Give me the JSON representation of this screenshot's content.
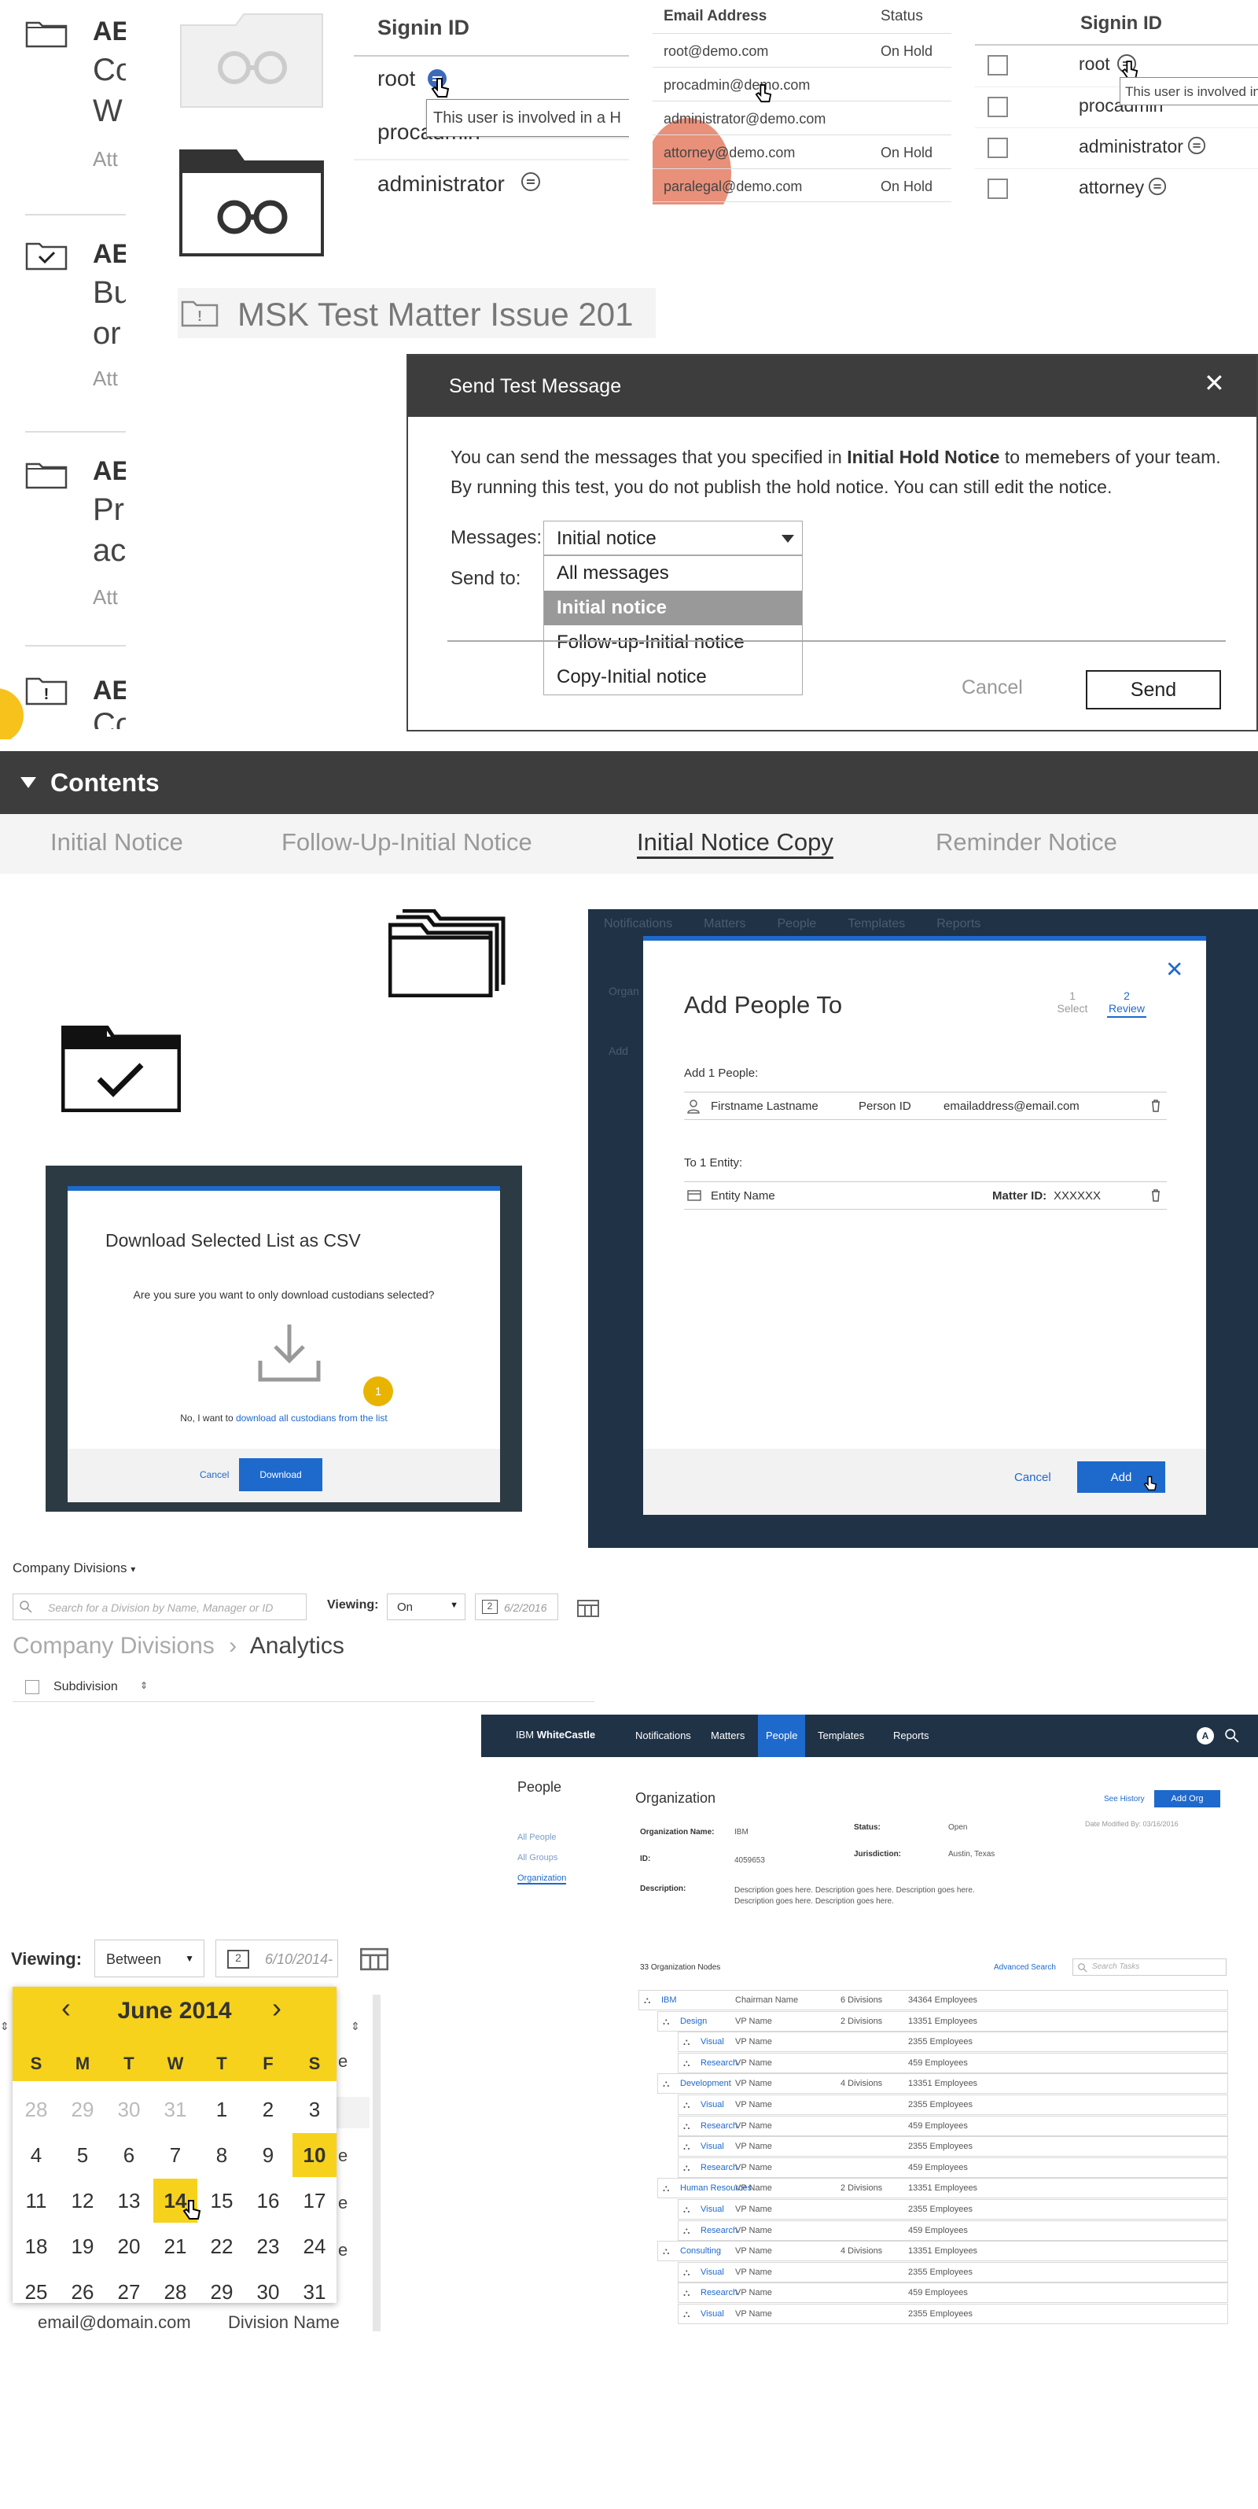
{
  "matters": {
    "items": [
      {
        "code": "AE",
        "line1": "Co",
        "line2": "W",
        "attorney": "Att",
        "icon": "folder-icon"
      },
      {
        "code": "AE",
        "line1": "Bu",
        "line2": "or",
        "attorney": "Att",
        "icon": "folder-check-icon"
      },
      {
        "code": "AE",
        "line1": "Pr",
        "line2": "ac",
        "attorney": "Att",
        "icon": "folder-icon"
      },
      {
        "code": "AE",
        "line1": "Co",
        "line2": "",
        "attorney": "",
        "icon": "folder-alert-icon"
      }
    ]
  },
  "signin_left": {
    "header": "Signin ID",
    "rows": [
      "root",
      "procadmin",
      "administrator"
    ],
    "tooltip": "This user is involved in a H"
  },
  "email_table": {
    "headers": [
      "Email Address",
      "Status"
    ],
    "rows": [
      {
        "email": "root@demo.com",
        "status": "On Hold"
      },
      {
        "email": "procadmin@demo.com",
        "status": ""
      },
      {
        "email": "administrator@demo.com",
        "status": ""
      },
      {
        "email": "attorney@demo.com",
        "status": "On Hold"
      },
      {
        "email": "paralegal@demo.com",
        "status": "On Hold"
      }
    ]
  },
  "signin_right": {
    "header": "Signin ID",
    "rows": [
      "root",
      "procadmin",
      "administrator",
      "attorney"
    ],
    "tooltip": "This user is involved in a"
  },
  "matter_title": "MSK Test Matter Issue 201",
  "send_dialog": {
    "title": "Send Test Message",
    "close": "✕",
    "para1_pre": "You can send the messages that you specified in ",
    "para1_bold": "Initial Hold Notice",
    "para1_post": " to memebers of your team.",
    "para2": "By running this test, you do not publish the hold notice. You can still edit the notice.",
    "messages_label": "Messages:",
    "messages_value": "Initial notice",
    "sendto_label": "Send to:",
    "options": [
      "All messages",
      "Initial notice",
      "Follow-up-Initial notice",
      "Copy-Initial notice"
    ],
    "selected_option": "Initial notice",
    "cancel": "Cancel",
    "send": "Send"
  },
  "contents": {
    "title": "Contents",
    "tabs": [
      "Initial Notice",
      "Follow-Up-Initial Notice",
      "Initial Notice Copy",
      "Reminder Notice"
    ],
    "active_tab": "Initial Notice Copy"
  },
  "csv_dialog": {
    "title": "Download Selected List as CSV",
    "question": "Are you sure you want to only download custodians selected?",
    "note_pre": "No, I want to ",
    "note_link": "download all custodians from the list",
    "badge": "1",
    "cancel": "Cancel",
    "download": "Download"
  },
  "add_people": {
    "title": "Add People To",
    "steps": [
      {
        "num": "1",
        "label": "Select"
      },
      {
        "num": "2",
        "label": "Review"
      }
    ],
    "people_label": "Add 1 People:",
    "person": {
      "name": "Firstname Lastname",
      "id": "Person ID",
      "email": "emailaddress@email.com"
    },
    "entity_label": "To 1 Entity:",
    "entity": {
      "name": "Entity Name",
      "matter_label": "Matter ID:",
      "matter_id": "XXXXXX"
    },
    "cancel": "Cancel",
    "add": "Add",
    "background_nav": [
      "Notifications",
      "Matters",
      "People",
      "Templates",
      "Reports"
    ],
    "background_side": [
      "Organ",
      "Add"
    ]
  },
  "divisions": {
    "dropdown": "Company Divisions",
    "search_placeholder": "Search for a Division by Name, Manager or ID",
    "viewing_label": "Viewing:",
    "viewing_value": "On",
    "date_icon_num": "2",
    "date_value": "6/2/2016",
    "breadcrumb": [
      "Company Divisions",
      "Analytics"
    ],
    "column": "Subdivision"
  },
  "org_app": {
    "brand_pre": "IBM ",
    "brand_bold": "WhiteCastle",
    "nav": [
      "Notifications",
      "Matters",
      "People",
      "Templates",
      "Reports"
    ],
    "active_nav": "People",
    "avatar": "A",
    "side_title": "People",
    "side_links": [
      "All People",
      "All Groups",
      "Organization"
    ],
    "page_title": "Organization",
    "see_history": "See History",
    "add_org": "Add Org",
    "date_modified": "Date Modified By: 03/16/2016",
    "fields": [
      {
        "label": "Organization Name:",
        "value": "IBM"
      },
      {
        "label": "Status:",
        "value": "Open"
      },
      {
        "label": "ID:",
        "value": "4059653"
      },
      {
        "label": "Jurisdiction:",
        "value": "Austin, Texas"
      },
      {
        "label": "Description:",
        "value": "Description goes here. Description goes here. Description goes here."
      },
      {
        "label": "",
        "value": "Description goes here. Description goes here."
      }
    ],
    "nodes_count": "33 Organization Nodes",
    "advanced_search": "Advanced Search",
    "search_placeholder": "Search Tasks",
    "tree": [
      {
        "level": 0,
        "name": "IBM",
        "person": "Chairman Name",
        "divisions": "6 Divisions",
        "employees": "34364 Employees"
      },
      {
        "level": 1,
        "name": "Design",
        "person": "VP Name",
        "divisions": "2 Divisions",
        "employees": "13351 Employees"
      },
      {
        "level": 2,
        "name": "Visual",
        "person": "VP Name",
        "divisions": "",
        "employees": "2355 Employees"
      },
      {
        "level": 2,
        "name": "Research",
        "person": "VP Name",
        "divisions": "",
        "employees": "459 Employees"
      },
      {
        "level": 1,
        "name": "Development",
        "person": "VP Name",
        "divisions": "4 Divisions",
        "employees": "13351 Employees"
      },
      {
        "level": 2,
        "name": "Visual",
        "person": "VP Name",
        "divisions": "",
        "employees": "2355 Employees"
      },
      {
        "level": 2,
        "name": "Research",
        "person": "VP Name",
        "divisions": "",
        "employees": "459 Employees"
      },
      {
        "level": 2,
        "name": "Visual",
        "person": "VP Name",
        "divisions": "",
        "employees": "2355 Employees"
      },
      {
        "level": 2,
        "name": "Research",
        "person": "VP Name",
        "divisions": "",
        "employees": "459 Employees"
      },
      {
        "level": 1,
        "name": "Human Resources",
        "person": "VP Name",
        "divisions": "2 Divisions",
        "employees": "13351 Employees"
      },
      {
        "level": 2,
        "name": "Visual",
        "person": "VP Name",
        "divisions": "",
        "employees": "2355 Employees"
      },
      {
        "level": 2,
        "name": "Research",
        "person": "VP Name",
        "divisions": "",
        "employees": "459 Employees"
      },
      {
        "level": 1,
        "name": "Consulting",
        "person": "VP Name",
        "divisions": "4 Divisions",
        "employees": "13351 Employees"
      },
      {
        "level": 2,
        "name": "Visual",
        "person": "VP Name",
        "divisions": "",
        "employees": "2355 Employees"
      },
      {
        "level": 2,
        "name": "Research",
        "person": "VP Name",
        "divisions": "",
        "employees": "459 Employees"
      },
      {
        "level": 2,
        "name": "Visual",
        "person": "VP Name",
        "divisions": "",
        "employees": "2355 Employees"
      }
    ]
  },
  "calendar": {
    "viewing_label": "Viewing:",
    "viewing_value": "Between",
    "date_icon_num": "2",
    "date_value": "6/10/2014-",
    "month": "June 2014",
    "prev": "‹",
    "next": "›",
    "weekdays": [
      "S",
      "M",
      "T",
      "W",
      "T",
      "F",
      "S"
    ],
    "weeks": [
      [
        "28",
        "29",
        "30",
        "31",
        "1",
        "2",
        "3"
      ],
      [
        "4",
        "5",
        "6",
        "7",
        "8",
        "9",
        "10"
      ],
      [
        "11",
        "12",
        "13",
        "14",
        "15",
        "16",
        "17"
      ],
      [
        "18",
        "19",
        "20",
        "21",
        "22",
        "23",
        "24"
      ],
      [
        "25",
        "26",
        "27",
        "28",
        "29",
        "30",
        "31"
      ]
    ],
    "muted_first_row_count": 4,
    "range_start": "10",
    "selected": "14",
    "footer_email": "email@domain.com",
    "footer_division": "Division Name",
    "right_col_letters": [
      "e",
      "e",
      "e",
      "e",
      "e"
    ]
  },
  "colors": {
    "accent_yellow": "#f7d21c",
    "ibm_blue": "#1e69cc",
    "dark_bar": "#3d3d3d",
    "nav_dark": "#1f3246"
  }
}
